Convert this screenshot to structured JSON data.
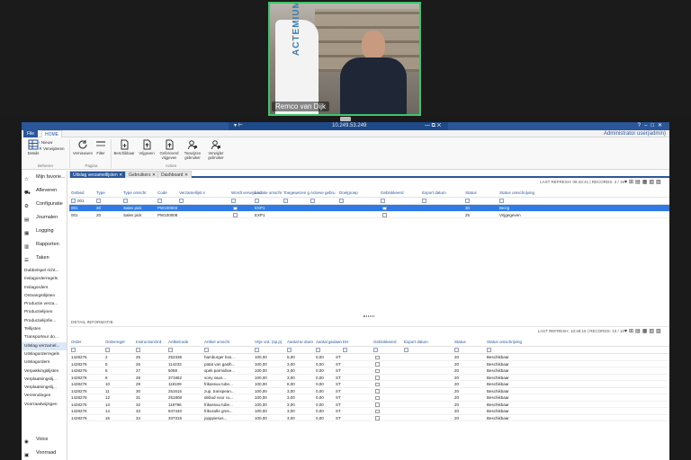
{
  "video": {
    "participant_name": "Remco van Dijk",
    "banner_text": "ACTEMIUM"
  },
  "window": {
    "title": "10.249.53.249",
    "user": "Administrator user(admin)"
  },
  "menu": {
    "file": "File",
    "home": "HOME"
  },
  "ribbon": {
    "groups": [
      {
        "label": "Beheren"
      },
      {
        "label": "Pagina"
      },
      {
        "label": "Acties"
      }
    ],
    "details": "Details",
    "small_buttons": [
      "Nieuw",
      "Verwijderen"
    ],
    "page_buttons": [
      "Vernieuwen",
      "Filter"
    ],
    "action_buttons": [
      "Beschikbaar",
      "Vrijgeven",
      "Geforceerd vrijgeven",
      "Toewijzen gebruiker",
      "Verwijder gebruiker"
    ]
  },
  "sidebar": {
    "big_items": [
      "Mijn favorie...",
      "Afleveren",
      "Configuratie",
      "Journalen",
      "Logging",
      "Rapporten",
      "Taken"
    ],
    "small_items": [
      "Dubbelspel richt...",
      "Inslagorderregels",
      "Inslagorders",
      "Ontvangstlijsten",
      "Productie verza...",
      "Productielijnen",
      "Productielijnfie...",
      "Tellijsten",
      "Transporteur do...",
      "Uitslag verzamel...",
      "Uitslagorderregels",
      "Uitslagorders",
      "Verpakkingslijsten",
      "Verplaatsingslij...",
      "Verplaatsingslij...",
      "Verzendingen",
      "Voorraadwijzigen"
    ],
    "active_small_index": 9,
    "bottom_items": [
      "Voice",
      "Voorraad"
    ]
  },
  "tabs": [
    "Uitslag verzamellijsten",
    "Gebruikers",
    "Dashboard"
  ],
  "top_grid": {
    "refresh": "LAST REFRESH: 08:43:41 | RECORDS: 2 / 15",
    "headers": [
      "Gebied",
      "Type",
      "Type omschr",
      "Code",
      "Verzamellijst s",
      "Wordt verwijderd",
      "Locatie omschr",
      "Toegewezen g",
      "Actieve gebru",
      "Doelgroep",
      "Geblokkeerd",
      "Export datum",
      "Status",
      "Status omschrijving"
    ],
    "filter_value": "001",
    "rows": [
      {
        "gebied": "001",
        "type": "20",
        "type_omschr": "Sales pick",
        "code": "PW100003",
        "locatie": "EXP1",
        "status": "30",
        "status_omschr": "Bezig"
      },
      {
        "gebied": "001",
        "type": "20",
        "type_omschr": "Sales pick",
        "code": "PW100008",
        "locatie": "EXP1",
        "status": "25",
        "status_omschr": "Vrijgegeven"
      }
    ]
  },
  "detail": {
    "title": "DETAIL INFORMATIE",
    "refresh": "LAST REFRESH: 10:48:15 | RECORDS: 10 / 10",
    "headers": [
      "Order",
      "Orderregel",
      "InstructionOrd",
      "Artikelcode",
      "Artikel omschr",
      "Vrije vrd. (sp.p)",
      "Aantal te doen",
      "Aantal gedaan",
      "EH",
      "Geblokkeerd",
      "Export datum",
      "Status",
      "Status omschrijving"
    ],
    "rows": [
      {
        "order": "1428276",
        "regel": "2",
        "instr": "25",
        "art": "252338",
        "oms": "hamburger bos...",
        "vrij": "100,00",
        "todo": "5,00",
        "done": "0,00",
        "eh": "ST",
        "status": "20",
        "status_omschr": "Beschikbaar"
      },
      {
        "order": "1428276",
        "regel": "5",
        "instr": "26",
        "art": "114233",
        "oms": "patat van gaslh...",
        "vrij": "100,00",
        "todo": "3,00",
        "done": "0,00",
        "eh": "ST",
        "status": "20",
        "status_omschr": "Beschikbaar"
      },
      {
        "order": "1428276",
        "regel": "6",
        "instr": "27",
        "art": "5058",
        "oms": "spek parmidixe...",
        "vrij": "100,00",
        "todo": "3,00",
        "done": "0,00",
        "eh": "ST",
        "status": "20",
        "status_omschr": "Beschikbaar"
      },
      {
        "order": "1428276",
        "regel": "8",
        "instr": "28",
        "art": "371862",
        "oms": "sony saus...",
        "vrij": "100,00",
        "todo": "3,00",
        "done": "0,00",
        "eh": "ST",
        "status": "20",
        "status_omschr": "Beschikbaar"
      },
      {
        "order": "1428276",
        "regel": "10",
        "instr": "29",
        "art": "118109",
        "oms": "frikassuu tube...",
        "vrij": "100,00",
        "todo": "8,00",
        "done": "0,00",
        "eh": "ST",
        "status": "20",
        "status_omschr": "Beschikbaar"
      },
      {
        "order": "1428276",
        "regel": "11",
        "instr": "30",
        "art": "251615",
        "oms": "zup. transpean...",
        "vrij": "100,00",
        "todo": "3,00",
        "done": "0,00",
        "eh": "ST",
        "status": "20",
        "status_omschr": "Beschikbaar"
      },
      {
        "order": "1428276",
        "regel": "12",
        "instr": "31",
        "art": "251808",
        "oms": "debud voor cu...",
        "vrij": "100,00",
        "todo": "3,00",
        "done": "0,00",
        "eh": "ST",
        "status": "20",
        "status_omschr": "Beschikbaar"
      },
      {
        "order": "1428276",
        "regel": "13",
        "instr": "32",
        "art": "118796",
        "oms": "frikassuu tube...",
        "vrij": "100,00",
        "todo": "3,00",
        "done": "0,00",
        "eh": "ST",
        "status": "20",
        "status_omschr": "Beschikbaar"
      },
      {
        "order": "1428276",
        "regel": "14",
        "instr": "33",
        "art": "847440",
        "oms": "frikusolle gres...",
        "vrij": "100,00",
        "todo": "3,00",
        "done": "0,00",
        "eh": "ST",
        "status": "20",
        "status_omschr": "Beschikbaar"
      },
      {
        "order": "1428276",
        "regel": "16",
        "instr": "34",
        "art": "337315",
        "oms": "jopppiesus...",
        "vrij": "100,00",
        "todo": "3,00",
        "done": "0,00",
        "eh": "ST",
        "status": "20",
        "status_omschr": "Beschikbaar"
      }
    ]
  },
  "colors": {
    "accent": "#2b579a",
    "selected_row": "#2f7ae5",
    "video_border": "#3ec46d"
  }
}
